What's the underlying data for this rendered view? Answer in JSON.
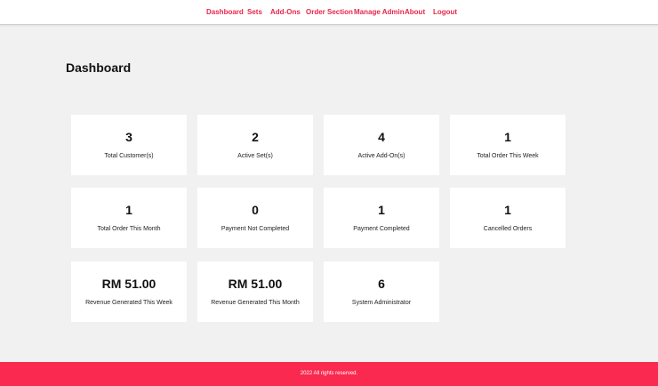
{
  "nav": {
    "items": [
      {
        "label": "Dashboard"
      },
      {
        "label": "Sets"
      },
      {
        "label": "Add-Ons"
      },
      {
        "label": "Order Section"
      },
      {
        "label": "Manage Admin"
      },
      {
        "label": "About"
      },
      {
        "label": "Logout"
      }
    ]
  },
  "page": {
    "title": "Dashboard"
  },
  "cards": [
    {
      "value": "3",
      "label": "Total Customer(s)"
    },
    {
      "value": "2",
      "label": "Active Set(s)"
    },
    {
      "value": "4",
      "label": "Active Add-On(s)"
    },
    {
      "value": "1",
      "label": "Total Order This Week"
    },
    {
      "value": "1",
      "label": "Total Order This Month"
    },
    {
      "value": "0",
      "label": "Payment Not Completed"
    },
    {
      "value": "1",
      "label": "Payment Completed"
    },
    {
      "value": "1",
      "label": "Cancelled Orders"
    },
    {
      "value": "RM 51.00",
      "label": "Revenue Generated This Week"
    },
    {
      "value": "RM 51.00",
      "label": "Revenue Generated This Month"
    },
    {
      "value": "6",
      "label": "System Administrator"
    }
  ],
  "footer": {
    "text": "2022 All rights reserved."
  },
  "colors": {
    "accent": "#f9294f",
    "nav_text": "#e8254a",
    "background": "#f1f1f1"
  }
}
